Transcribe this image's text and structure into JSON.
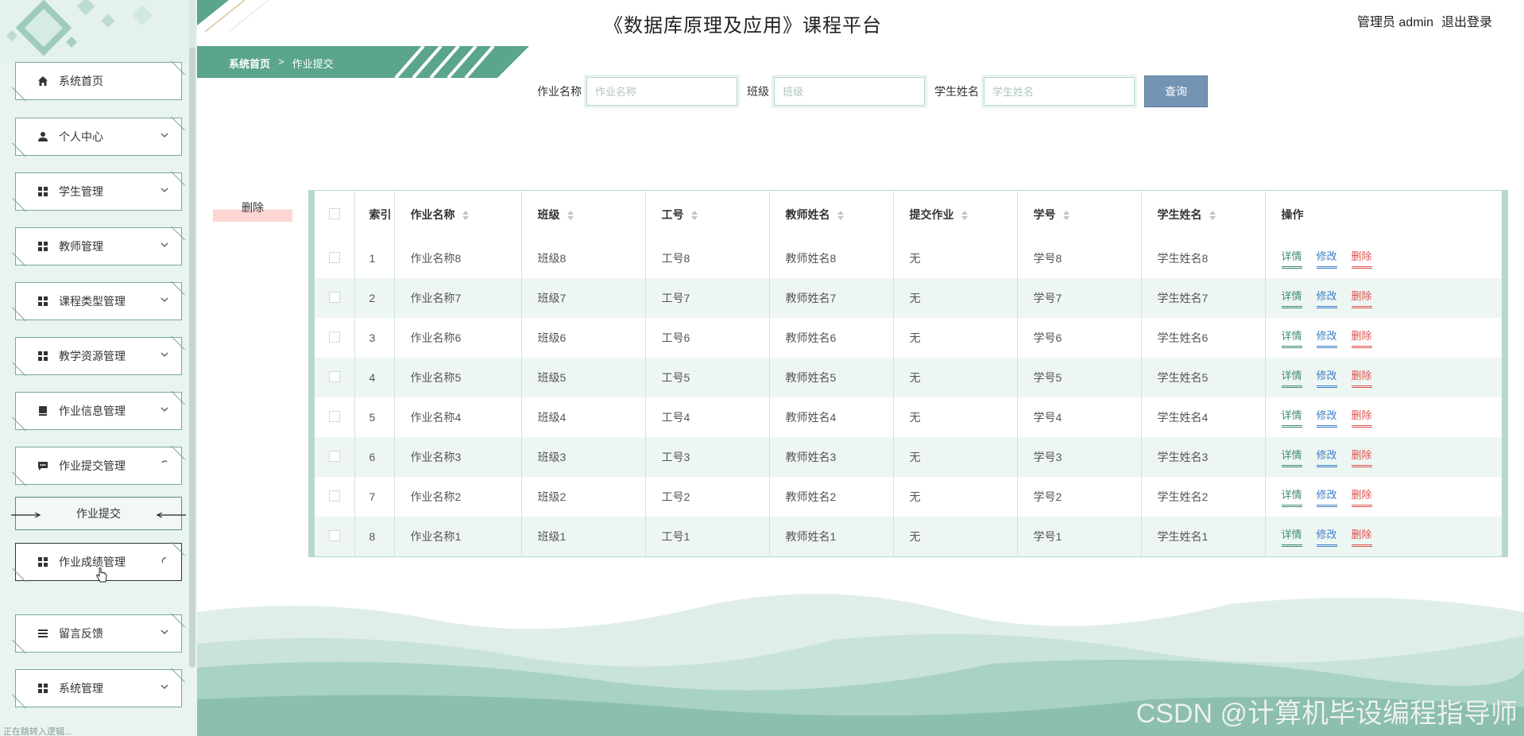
{
  "app": {
    "title": "《数据库原理及应用》课程平台",
    "user_role": "管理员",
    "username": "admin",
    "logout_label": "退出登录"
  },
  "sidebar": {
    "items": [
      {
        "label": "系统首页",
        "icon": "home-icon"
      },
      {
        "label": "个人中心",
        "icon": "user-icon"
      },
      {
        "label": "学生管理",
        "icon": "grid-icon"
      },
      {
        "label": "教师管理",
        "icon": "grid-icon"
      },
      {
        "label": "课程类型管理",
        "icon": "grid-icon"
      },
      {
        "label": "教学资源管理",
        "icon": "grid-icon"
      },
      {
        "label": "作业信息管理",
        "icon": "book-icon"
      },
      {
        "label": "作业提交管理",
        "icon": "chat-icon"
      },
      {
        "label": "作业成绩管理",
        "icon": "grid-icon"
      },
      {
        "label": "留言反馈",
        "icon": "list-icon"
      },
      {
        "label": "系统管理",
        "icon": "grid-icon"
      }
    ],
    "submenu": {
      "label": "作业提交"
    },
    "status_text": "正在跳转入逻辑..."
  },
  "breadcrumb": {
    "home": "系统首页",
    "separator": ">",
    "current": "作业提交"
  },
  "search": {
    "fields": [
      {
        "label": "作业名称",
        "placeholder": "作业名称"
      },
      {
        "label": "班级",
        "placeholder": "班级"
      },
      {
        "label": "学生姓名",
        "placeholder": "学生姓名"
      }
    ],
    "query_label": "查询"
  },
  "toolbar": {
    "delete_label": "删除"
  },
  "table": {
    "index_header": "索引",
    "columns": [
      "作业名称",
      "班级",
      "工号",
      "教师姓名",
      "提交作业",
      "学号",
      "学生姓名"
    ],
    "actions_header": "操作",
    "action_labels": {
      "detail": "详情",
      "edit": "修改",
      "delete": "删除"
    },
    "rows": [
      {
        "index": "1",
        "cells": [
          "作业名称8",
          "班级8",
          "工号8",
          "教师姓名8",
          "无",
          "学号8",
          "学生姓名8"
        ]
      },
      {
        "index": "2",
        "cells": [
          "作业名称7",
          "班级7",
          "工号7",
          "教师姓名7",
          "无",
          "学号7",
          "学生姓名7"
        ]
      },
      {
        "index": "3",
        "cells": [
          "作业名称6",
          "班级6",
          "工号6",
          "教师姓名6",
          "无",
          "学号6",
          "学生姓名6"
        ]
      },
      {
        "index": "4",
        "cells": [
          "作业名称5",
          "班级5",
          "工号5",
          "教师姓名5",
          "无",
          "学号5",
          "学生姓名5"
        ]
      },
      {
        "index": "5",
        "cells": [
          "作业名称4",
          "班级4",
          "工号4",
          "教师姓名4",
          "无",
          "学号4",
          "学生姓名4"
        ]
      },
      {
        "index": "6",
        "cells": [
          "作业名称3",
          "班级3",
          "工号3",
          "教师姓名3",
          "无",
          "学号3",
          "学生姓名3"
        ]
      },
      {
        "index": "7",
        "cells": [
          "作业名称2",
          "班级2",
          "工号2",
          "教师姓名2",
          "无",
          "学号2",
          "学生姓名2"
        ]
      },
      {
        "index": "8",
        "cells": [
          "作业名称1",
          "班级1",
          "工号1",
          "教师姓名1",
          "无",
          "学号1",
          "学生姓名1"
        ]
      }
    ]
  },
  "watermark": "CSDN @计算机毕设编程指导师",
  "colors": {
    "accent": "#5aa58c",
    "sidebar_bg": "#e9f4ef",
    "query_button": "#7394b3",
    "detail": "#3d8a74",
    "edit": "#3b7fc4",
    "delete": "#d9534f"
  }
}
